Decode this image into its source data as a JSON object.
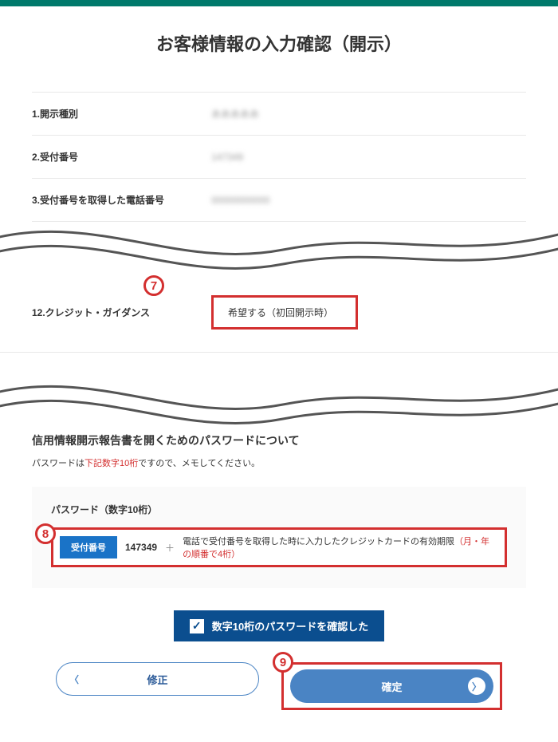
{
  "topbar_color": "#00796b",
  "title": "お客様情報の入力確認（開示）",
  "rows": [
    {
      "label": "1.開示種別",
      "value": "あああああ"
    },
    {
      "label": "2.受付番号",
      "value": "147349"
    },
    {
      "label": "3.受付番号を取得した電話番号",
      "value": "00000000000"
    }
  ],
  "row12": {
    "label": "12.クレジット・ガイダンス",
    "value": "希望する（初回開示時）"
  },
  "annotations": {
    "a7": "7",
    "a8": "8",
    "a9": "9"
  },
  "section2": {
    "title": "信用情報開示報告書を開くためのパスワードについて",
    "note_prefix": "パスワードは",
    "note_red": "下記数字10桁",
    "note_suffix": "ですので、メモしてください。"
  },
  "password": {
    "heading": "パスワード（数字10桁）",
    "badge": "受付番号",
    "number": "147349",
    "plus": "＋",
    "desc": "電話で受付番号を取得した時に入力したクレジットカードの有効期限",
    "desc_red": "（月・年の順番で4桁）"
  },
  "confirm_button": "数字10桁のパスワードを確認した",
  "buttons": {
    "back": "修正",
    "next": "確定"
  }
}
